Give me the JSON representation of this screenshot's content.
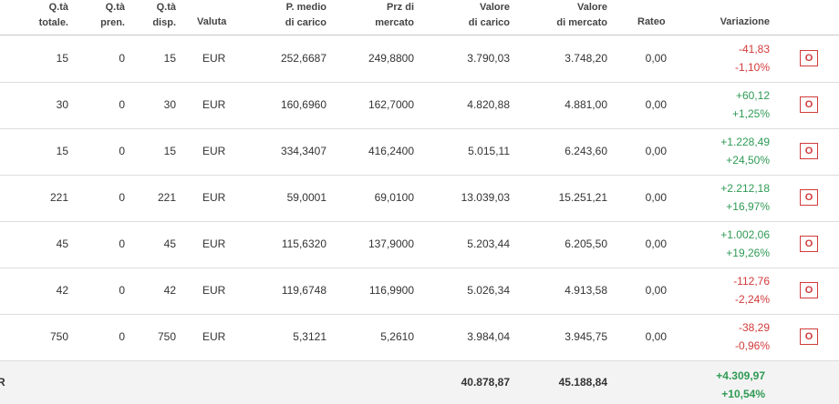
{
  "headers": {
    "qty_total": [
      "Q.tà",
      "totale."
    ],
    "qty_pren": [
      "Q.tà",
      "pren."
    ],
    "qty_disp": [
      "Q.tà",
      "disp."
    ],
    "currency": "Valuta",
    "avg_price": [
      "P. medio",
      "di carico"
    ],
    "market_price": [
      "Prz di",
      "mercato"
    ],
    "load_value": [
      "Valore",
      "di carico"
    ],
    "market_value": [
      "Valore",
      "di mercato"
    ],
    "accrual": "Rateo",
    "variation": "Variazione"
  },
  "rows": [
    {
      "qty_total": "15",
      "qty_pren": "0",
      "qty_disp": "15",
      "currency": "EUR",
      "avg_price": "252,6687",
      "market_price": "249,8800",
      "load_value": "3.790,03",
      "market_value": "3.748,20",
      "accrual": "0,00",
      "var_abs": "-41,83",
      "var_pct": "-1,10%",
      "trend": "neg",
      "action": "O"
    },
    {
      "qty_total": "30",
      "qty_pren": "0",
      "qty_disp": "30",
      "currency": "EUR",
      "avg_price": "160,6960",
      "market_price": "162,7000",
      "load_value": "4.820,88",
      "market_value": "4.881,00",
      "accrual": "0,00",
      "var_abs": "+60,12",
      "var_pct": "+1,25%",
      "trend": "pos",
      "action": "O"
    },
    {
      "qty_total": "15",
      "qty_pren": "0",
      "qty_disp": "15",
      "currency": "EUR",
      "avg_price": "334,3407",
      "market_price": "416,2400",
      "load_value": "5.015,11",
      "market_value": "6.243,60",
      "accrual": "0,00",
      "var_abs": "+1.228,49",
      "var_pct": "+24,50%",
      "trend": "pos",
      "action": "O"
    },
    {
      "qty_total": "221",
      "qty_pren": "0",
      "qty_disp": "221",
      "currency": "EUR",
      "avg_price": "59,0001",
      "market_price": "69,0100",
      "load_value": "13.039,03",
      "market_value": "15.251,21",
      "accrual": "0,00",
      "var_abs": "+2.212,18",
      "var_pct": "+16,97%",
      "trend": "pos",
      "action": "O"
    },
    {
      "qty_total": "45",
      "qty_pren": "0",
      "qty_disp": "45",
      "currency": "EUR",
      "avg_price": "115,6320",
      "market_price": "137,9000",
      "load_value": "5.203,44",
      "market_value": "6.205,50",
      "accrual": "0,00",
      "var_abs": "+1.002,06",
      "var_pct": "+19,26%",
      "trend": "pos",
      "action": "O"
    },
    {
      "qty_total": "42",
      "qty_pren": "0",
      "qty_disp": "42",
      "currency": "EUR",
      "avg_price": "119,6748",
      "market_price": "116,9900",
      "load_value": "5.026,34",
      "market_value": "4.913,58",
      "accrual": "0,00",
      "var_abs": "-112,76",
      "var_pct": "-2,24%",
      "trend": "neg",
      "action": "O"
    },
    {
      "qty_total": "750",
      "qty_pren": "0",
      "qty_disp": "750",
      "currency": "EUR",
      "avg_price": "5,3121",
      "market_price": "5,2610",
      "load_value": "3.984,04",
      "market_value": "3.945,75",
      "accrual": "0,00",
      "var_abs": "-38,29",
      "var_pct": "-0,96%",
      "trend": "neg",
      "action": "O"
    }
  ],
  "total": {
    "label_fragment": "R",
    "load_value": "40.878,87",
    "market_value": "45.188,84",
    "var_abs": "+4.309,97",
    "var_pct": "+10,54%"
  },
  "colors": {
    "negative": "#d23a3a",
    "positive": "#2f9a55",
    "total_bg": "#f3f3f3"
  }
}
